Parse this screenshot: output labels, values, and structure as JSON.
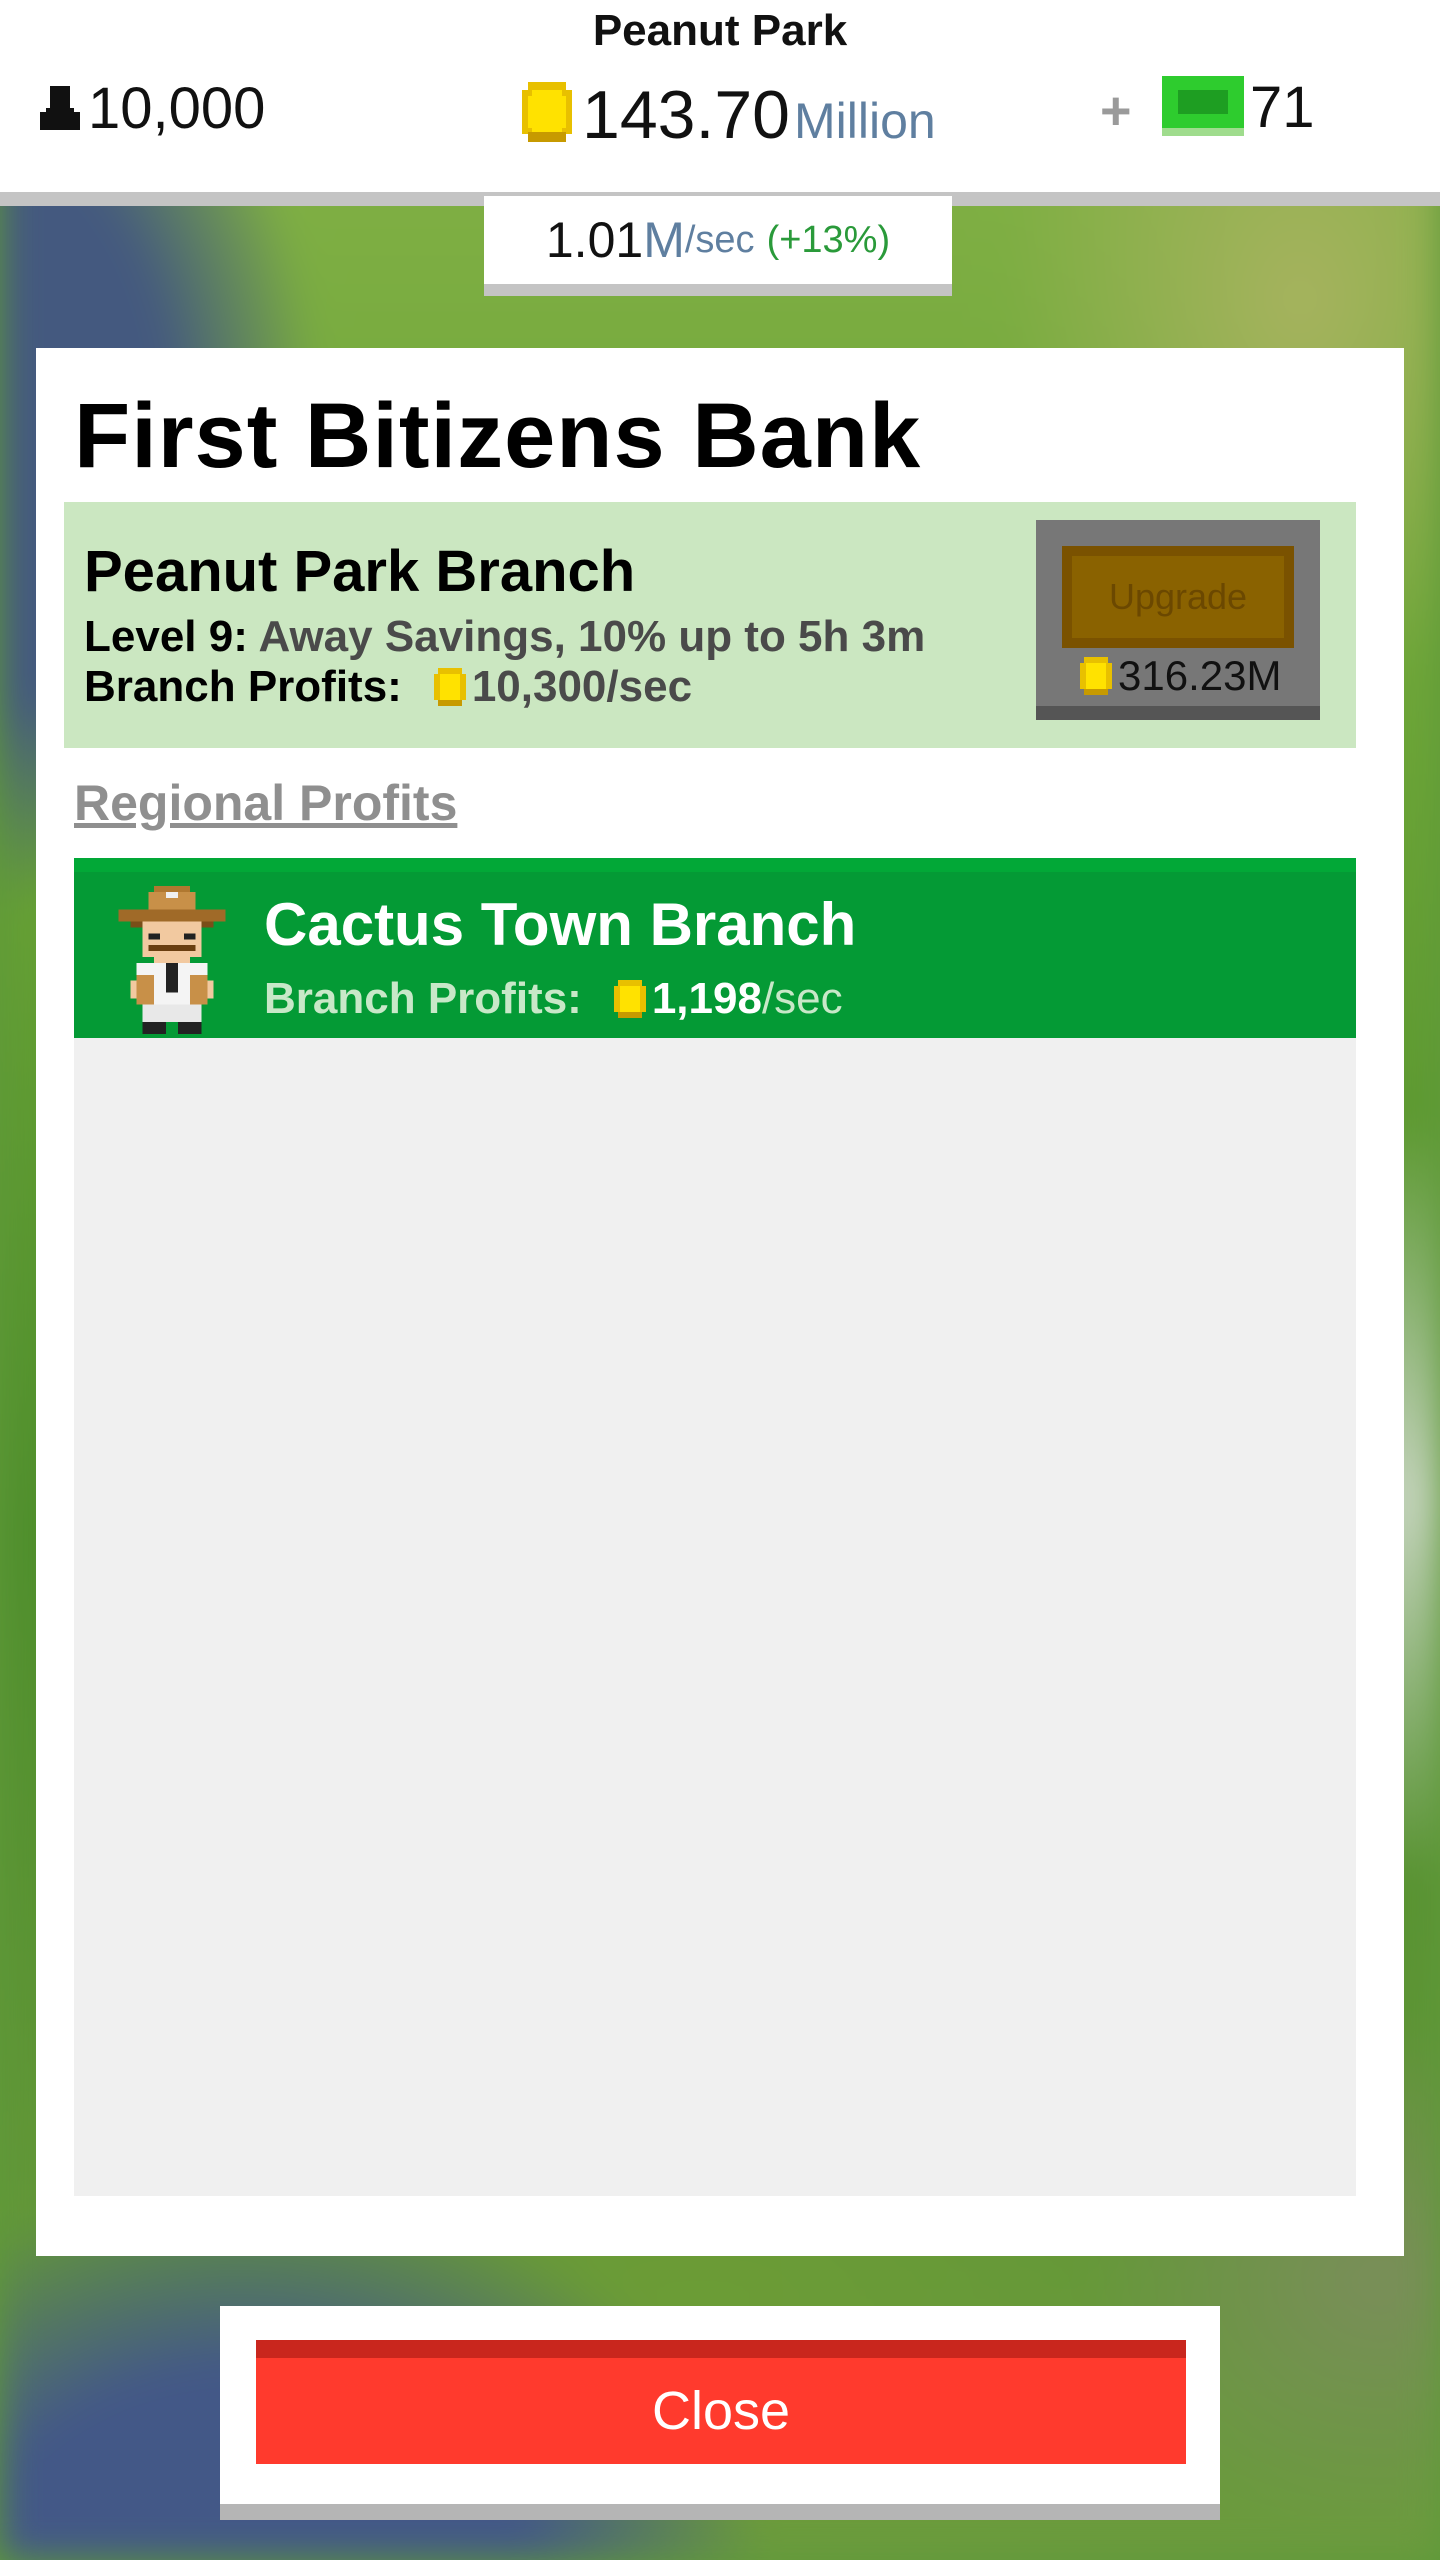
{
  "hud": {
    "city_name": "Peanut Park",
    "population": "10,000",
    "money_value": "143.70",
    "money_unit": "Million",
    "plus_label": "+",
    "bux": "71",
    "rate_value": "1.01",
    "rate_unit_m": "M",
    "rate_unit_sec": "/sec",
    "rate_pct": "(+13%)"
  },
  "panel": {
    "title": "First Bitizens Bank",
    "branch": {
      "name": "Peanut Park Branch",
      "level_label": "Level 9:",
      "level_desc": " Away Savings, 10% up to 5h 3m",
      "profits_label": "Branch Profits:",
      "profits_value": "10,300/sec",
      "upgrade_label": "Upgrade",
      "upgrade_cost": "316.23M"
    },
    "section_label": "Regional Profits",
    "regional": [
      {
        "name": "Cactus Town Branch",
        "profits_label": "Branch Profits:",
        "profits_value": "1,198",
        "profits_unit": "/sec"
      }
    ]
  },
  "close_label": "Close",
  "colors": {
    "branch_card_bg": "#cbe7c1",
    "regional_item_bg": "#049a35",
    "close_btn": "#ff3a2d",
    "upgrade_btn": "#8a6200",
    "money_unit": "#5f7fa0",
    "rate_pct": "#2a9a3a"
  },
  "icons": [
    "person-icon",
    "coin-icon",
    "bux-icon",
    "cowboy-avatar-icon"
  ]
}
